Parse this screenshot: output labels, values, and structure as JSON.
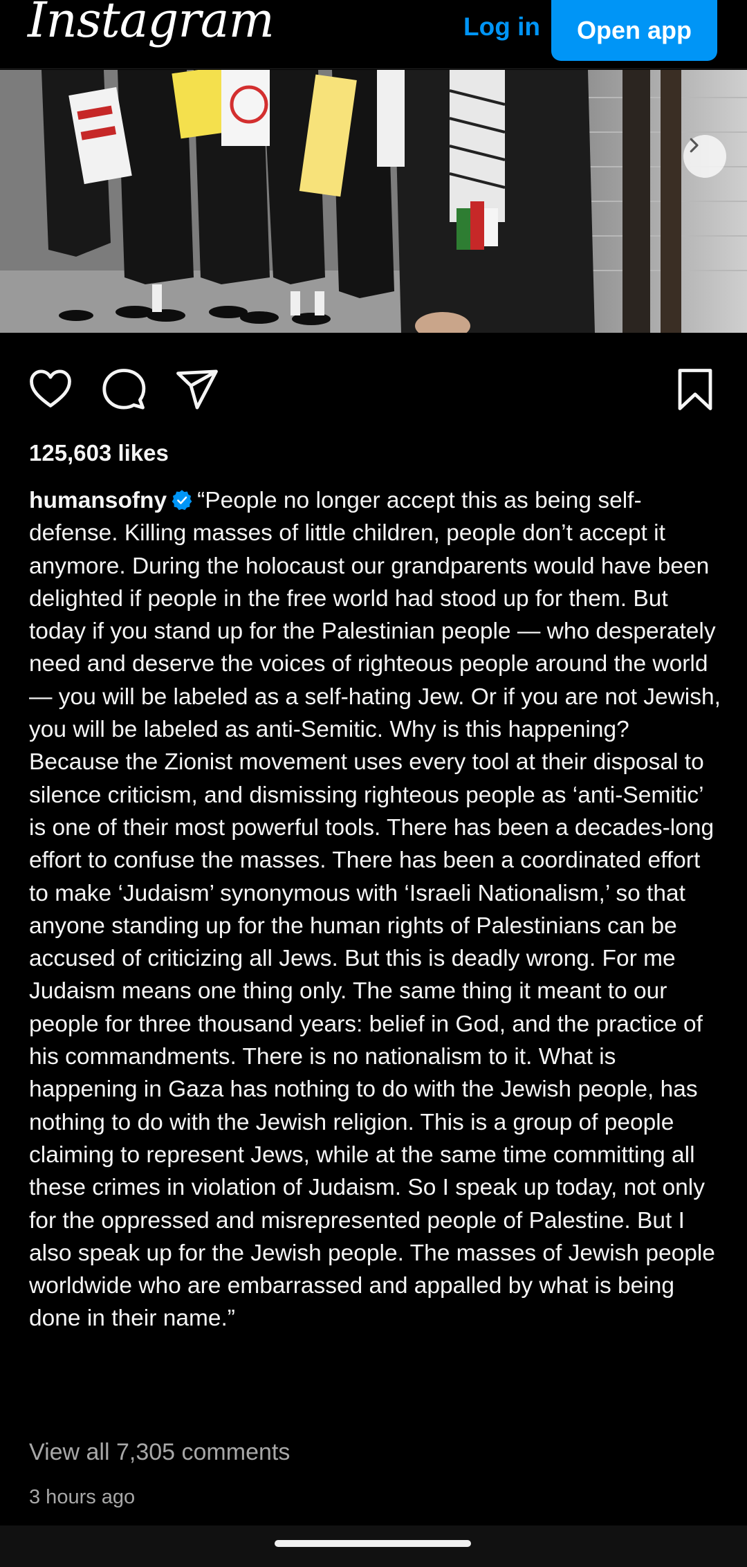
{
  "header": {
    "logo": "Instagram",
    "login_label": "Log in",
    "open_app_label": "Open app"
  },
  "carousel": {
    "slide_count": 2,
    "active_index": 1
  },
  "post": {
    "likes": "125,603 likes",
    "username": "humansofny",
    "verified": true,
    "caption": "“People no longer accept this as being self-defense. Killing masses of little children, people don’t accept it anymore. During the holocaust our grandparents would have been delighted if people in the free world had stood up for them. But today if you stand up for the Palestinian people — who desperately need and deserve the voices of righteous people around the world— you will be labeled as a self-hating Jew. Or if you are not Jewish, you will be labeled as anti-Semitic. Why is this happening? Because the Zionist movement uses every tool at their disposal to silence criticism, and dismissing righteous people as ‘anti-Semitic’ is one of their most powerful tools. There has been a decades-long effort to confuse the masses. There has been a coordinated effort to make ‘Judaism’ synonymous with ‘Israeli Nationalism,’ so that anyone standing up for the human rights of Palestinians can be accused of criticizing all Jews. But this is deadly wrong. For me Judaism means one thing only. The same thing it meant to our people for three thousand years: belief in God, and the practice of his commandments. There is no nationalism to it. What is happening in Gaza has nothing to do with the Jewish people, has nothing to do with the Jewish religion. This is a group of people claiming to represent Jews, while at the same time committing all these crimes in violation of Judaism. So I speak up today, not only for the oppressed and misrepresented people of Palestine. But I also speak up for the Jewish people. The masses of Jewish people worldwide who are embarrassed and appalled by what is being done in their name.”",
    "view_comments": "View all 7,305 comments",
    "timestamp": "3 hours ago"
  },
  "colors": {
    "accent": "#0095f6",
    "background": "#000000",
    "text": "#f5f5f5",
    "muted": "#a8a8a8",
    "verified": "#0095f6"
  },
  "icons": [
    "heart-icon",
    "comment-icon",
    "share-icon",
    "bookmark-icon",
    "verified-badge-icon",
    "chevron-right-icon"
  ]
}
